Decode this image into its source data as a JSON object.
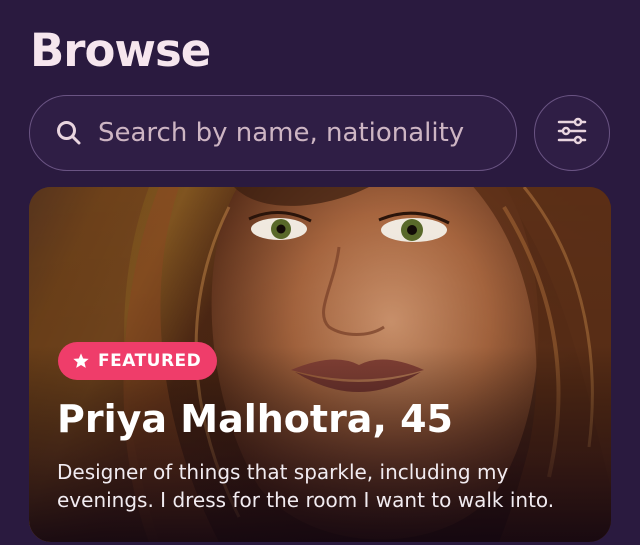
{
  "header": {
    "title": "Browse"
  },
  "search": {
    "placeholder": "Search by name, nationality"
  },
  "filter": {
    "icon": "sliders-icon"
  },
  "featured_card": {
    "badge_label": "FEATURED",
    "badge_icon": "star-icon",
    "name_age": "Priya Malhotra, 45",
    "bio": "Designer of things that sparkle, including my evenings. I dress for the room I want to walk into."
  },
  "colors": {
    "background": "#2a1a3f",
    "field_border": "#6a5483",
    "badge": "#ef3d6a",
    "title": "#f6e6ee"
  }
}
